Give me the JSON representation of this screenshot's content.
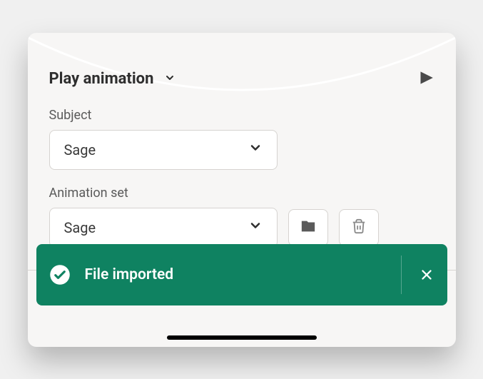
{
  "header": {
    "title": "Play animation"
  },
  "form": {
    "subject_label": "Subject",
    "subject_value": "Sage",
    "animation_set_label": "Animation set",
    "animation_set_value": "Sage"
  },
  "toast": {
    "message": "File imported"
  },
  "icons": {
    "chevron_down": "chevron-down-icon",
    "play": "play-icon",
    "folder": "folder-icon",
    "trash": "trash-icon",
    "check_circle": "check-circle-icon",
    "close": "close-icon"
  },
  "colors": {
    "toast_bg": "#0f8261",
    "text_primary": "#2e2e2e",
    "text_secondary": "#5a5a5a",
    "border": "#d6d3d0"
  }
}
